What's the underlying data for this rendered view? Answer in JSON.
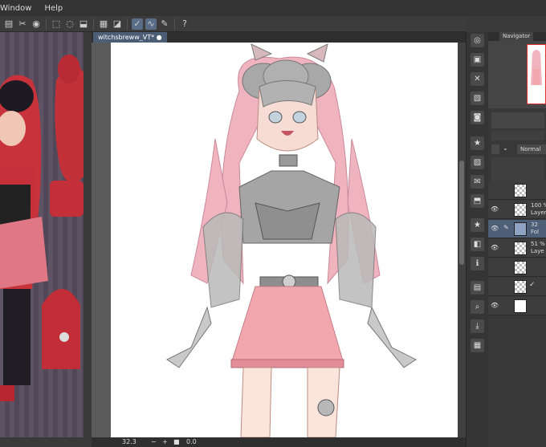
{
  "menubar": {
    "items": [
      "Window",
      "Help"
    ]
  },
  "toolbar": {
    "icons": [
      "layers-icon",
      "cut-icon",
      "fill-icon",
      "select-icon",
      "lasso-icon",
      "transform-icon",
      "grid-icon",
      "ruler-icon",
      "pen-stroke-icon",
      "curve-icon",
      "pen-icon",
      "help-icon"
    ]
  },
  "document": {
    "tab_title": "witchsbreww_VT*",
    "zoom": "32.3",
    "angle": "0.0"
  },
  "navigator": {
    "tab_label": "Navigator"
  },
  "layers": {
    "blend_mode": "Normal",
    "rows": [
      {
        "opacity": "",
        "name": ""
      },
      {
        "opacity": "100 %",
        "name": "Layer"
      },
      {
        "opacity": "32",
        "name": "Fol"
      },
      {
        "opacity": "51 %",
        "name": "Laye"
      },
      {
        "opacity": "",
        "name": ""
      },
      {
        "opacity": "",
        "name": ""
      },
      {
        "opacity": "",
        "name": ""
      }
    ]
  },
  "colors": {
    "accent": "#4e5f78",
    "skirt": "#f2a7ae",
    "hair": "#e99aa8"
  }
}
